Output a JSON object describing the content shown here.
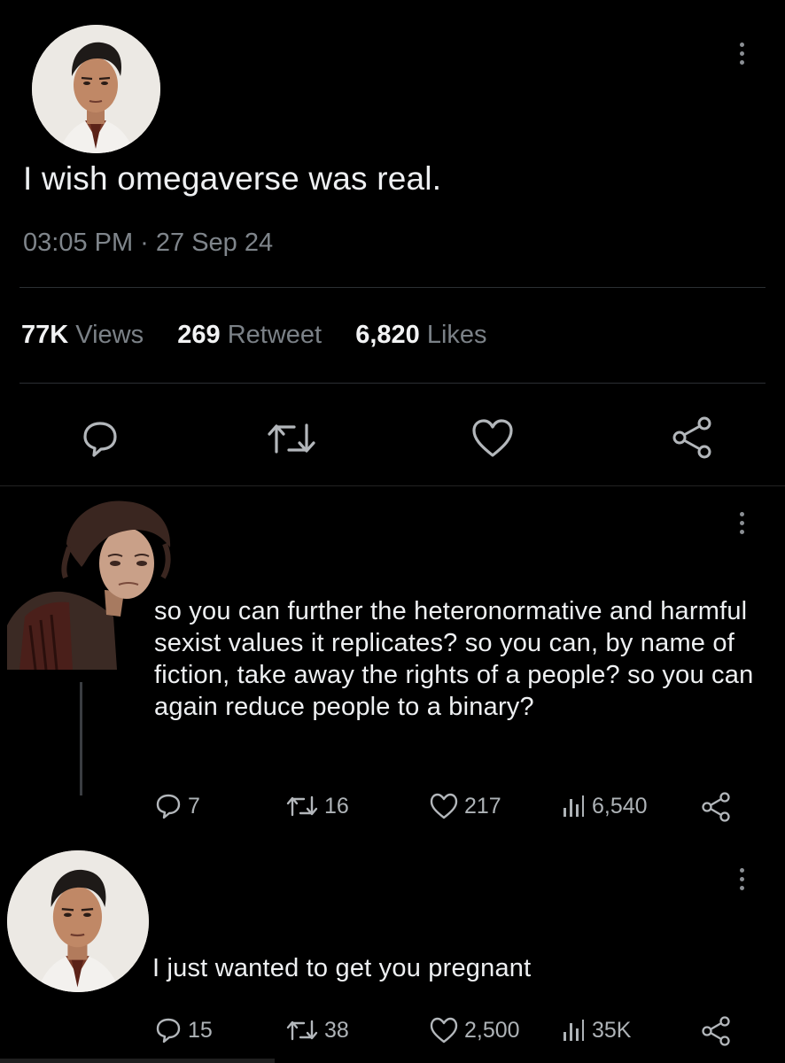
{
  "tweet1": {
    "avatar": "male-character-portrait-avatar",
    "text": "I wish omegaverse was real.",
    "timestamp": "03:05 PM · 27 Sep 24",
    "stats": {
      "views_count": "77K",
      "views_label": "Views",
      "retweets_count": "269",
      "retweets_label": "Retweet",
      "likes_count": "6,820",
      "likes_label": "Likes"
    },
    "actions": [
      "reply-icon",
      "retweet-icon",
      "like-icon",
      "share-icon"
    ]
  },
  "reply1": {
    "avatar": "tearful-character-portrait",
    "text": "so you can further the heteronormative and harmful sexist values it replicates? so you can, by name of fiction, take away the rights of a people? so you can again reduce people to a binary?",
    "replies": "7",
    "retweets": "16",
    "likes": "217",
    "views": "6,540"
  },
  "reply2": {
    "avatar": "male-character-portrait-avatar",
    "text": "I just wanted to get you pregnant",
    "replies": "15",
    "retweets": "38",
    "likes": "2,500",
    "views": "35K"
  },
  "colors": {
    "background": "#000000",
    "text": "#eef0f2",
    "muted": "#7f858b",
    "divider": "#2b2f33"
  }
}
